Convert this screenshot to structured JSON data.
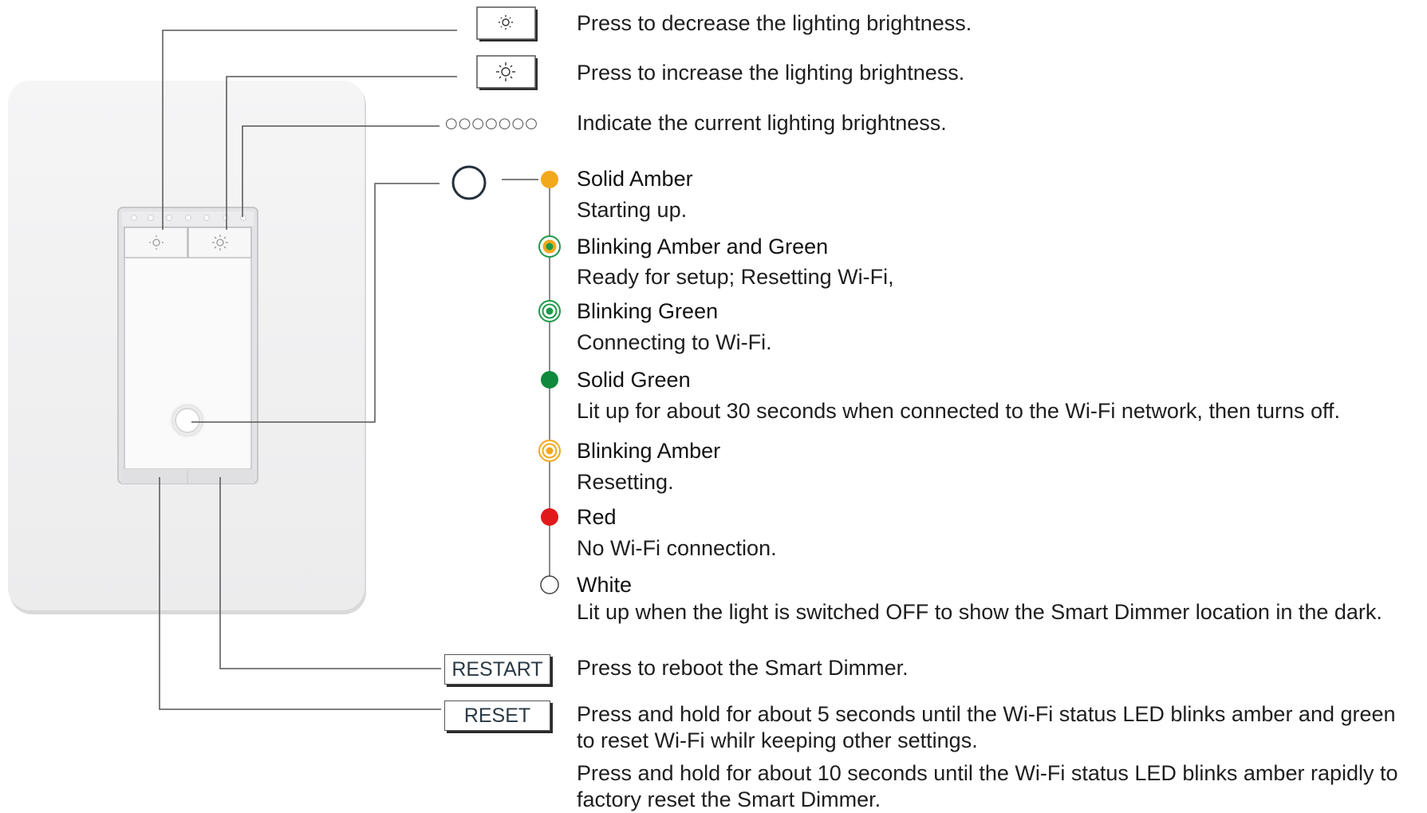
{
  "buttons": {
    "decrease_desc": "Press to decrease the lighting brightness.",
    "increase_desc": "Press to increase the lighting brightness.",
    "indicator_symbol": "○○○○○○○",
    "indicator_desc": "Indicate the current lighting brightness.",
    "decrease_icon": "dim-sun-icon",
    "increase_icon": "bright-sun-icon"
  },
  "led_states": [
    {
      "title": "Solid Amber",
      "desc": "Starting up.",
      "color": "#f2a81d",
      "style": "solid"
    },
    {
      "title": "Blinking Amber and Green",
      "desc": "Ready for setup; Resetting Wi-Fi,",
      "color": "#f2a81d",
      "accent": "#1e9a4a",
      "style": "blink-dual"
    },
    {
      "title": "Blinking Green",
      "desc": "Connecting to Wi-Fi.",
      "color": "#1e9a4a",
      "style": "blink"
    },
    {
      "title": "Solid Green",
      "desc": "Lit up for about 30 seconds when connected to the Wi-Fi network, then turns off.",
      "color": "#0f8a3c",
      "style": "solid"
    },
    {
      "title": "Blinking Amber",
      "desc": "Resetting.",
      "color": "#f2a81d",
      "style": "blink"
    },
    {
      "title": "Red",
      "desc": "No Wi-Fi connection.",
      "color": "#e01a1a",
      "style": "solid"
    },
    {
      "title": "White",
      "desc": "Lit up when the light is switched OFF to show the Smart Dimmer location in the dark.",
      "color": "#ffffff",
      "style": "outline"
    }
  ],
  "restart": {
    "label": "RESTART",
    "desc": "Press to reboot the Smart Dimmer."
  },
  "reset": {
    "label": "RESET",
    "desc_1a": "Press and hold for about 5 seconds until the Wi-Fi status LED blinks amber and green",
    "desc_1b": "to reset Wi-Fi whilr keeping other settings.",
    "desc_2a": "Press and hold for about 10 seconds until the Wi-Fi status LED blinks amber rapidly to",
    "desc_2b": "factory reset the Smart Dimmer."
  }
}
